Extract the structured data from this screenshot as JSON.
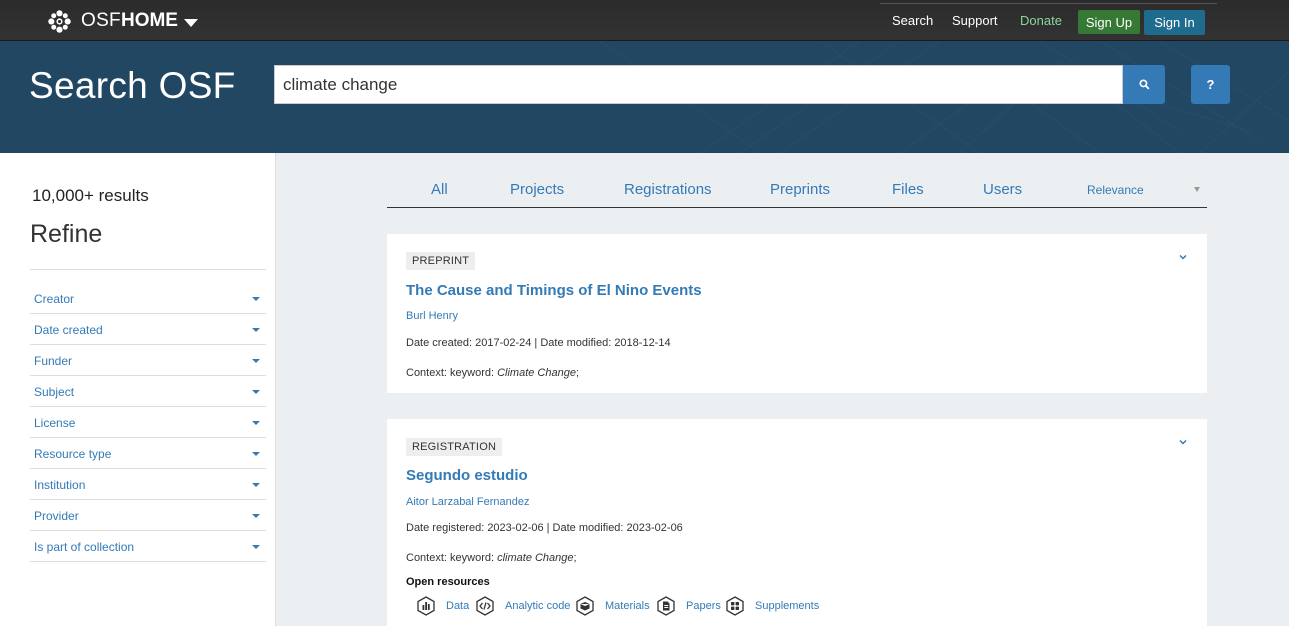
{
  "nav": {
    "brand_osf": "OSF",
    "brand_home": "HOME",
    "links": {
      "search": "Search",
      "support": "Support",
      "donate": "Donate"
    },
    "sign_up": "Sign Up",
    "sign_in": "Sign In"
  },
  "hero": {
    "title": "Search OSF",
    "query": "climate change",
    "help": "?"
  },
  "sidebar": {
    "result_count": "10,000+ results",
    "refine": "Refine",
    "facets": [
      "Creator",
      "Date created",
      "Funder",
      "Subject",
      "License",
      "Resource type",
      "Institution",
      "Provider",
      "Is part of collection"
    ]
  },
  "tabs": [
    "All",
    "Projects",
    "Registrations",
    "Preprints",
    "Files",
    "Users"
  ],
  "sort": {
    "selected": "Relevance"
  },
  "results": [
    {
      "badge": "PREPRINT",
      "title": "The Cause and Timings of El Nino Events",
      "author": "Burl Henry",
      "dates": "Date created: 2017-02-24 | Date modified: 2018-12-14",
      "context_prefix": "Context: keyword: ",
      "context_keyword": "Climate Change",
      "context_suffix": ";"
    },
    {
      "badge": "REGISTRATION",
      "title": "Segundo estudio",
      "author": "Aitor Larzabal Fernandez",
      "dates": "Date registered: 2023-02-06 | Date modified: 2023-02-06",
      "context_prefix": "Context: keyword: ",
      "context_keyword": "climate Change",
      "context_suffix": ";",
      "open_resources_title": "Open resources",
      "open_resources": [
        "Data",
        "Analytic code",
        "Materials",
        "Papers",
        "Supplements"
      ]
    }
  ],
  "colors": {
    "navbar": "#2b2b2b",
    "hero": "#214762",
    "link": "#337ab7",
    "signup": "#357935",
    "signin": "#1f6b8e",
    "donate": "#8bd69a"
  }
}
